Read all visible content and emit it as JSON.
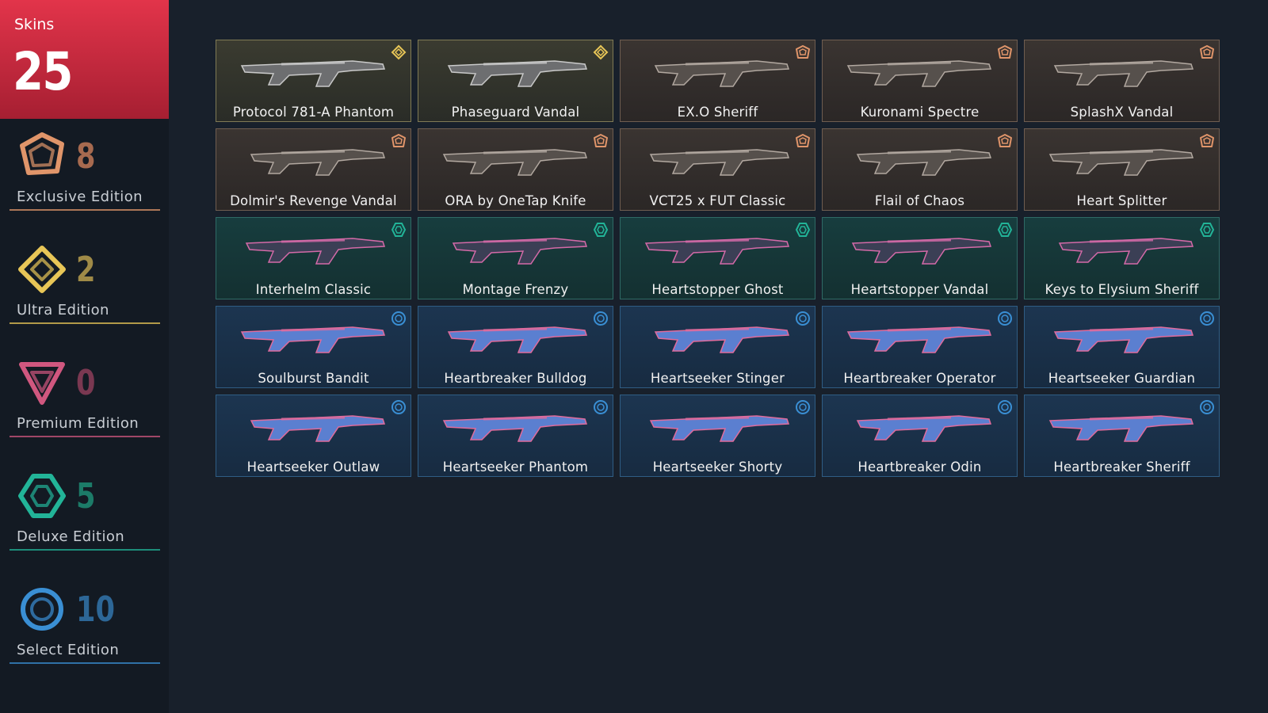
{
  "sidebar": {
    "skins_label": "Skins",
    "skins_count": "25",
    "header_color": "#e2344a",
    "editions": [
      {
        "count": "8",
        "label": "Exclusive Edition",
        "color": "#e0956a",
        "icon": "exclusive-edition-icon"
      },
      {
        "count": "2",
        "label": "Ultra Edition",
        "color": "#e8c657",
        "icon": "ultra-edition-icon"
      },
      {
        "count": "0",
        "label": "Premium Edition",
        "color": "#d0577f",
        "icon": "premium-edition-icon"
      },
      {
        "count": "5",
        "label": "Deluxe Edition",
        "color": "#22b498",
        "icon": "deluxe-edition-icon"
      },
      {
        "count": "10",
        "label": "Select Edition",
        "color": "#3a8fd4",
        "icon": "select-edition-icon"
      }
    ]
  },
  "skins": [
    {
      "name": "Protocol 781-A Phantom",
      "tier": "ultra"
    },
    {
      "name": "Phaseguard Vandal",
      "tier": "ultra"
    },
    {
      "name": "EX.O Sheriff",
      "tier": "exclusive"
    },
    {
      "name": "Kuronami Spectre",
      "tier": "exclusive"
    },
    {
      "name": "SplashX Vandal",
      "tier": "exclusive"
    },
    {
      "name": "Dolmir's Revenge Vandal",
      "tier": "exclusive"
    },
    {
      "name": "ORA by OneTap Knife",
      "tier": "exclusive"
    },
    {
      "name": "VCT25 x FUT Classic",
      "tier": "exclusive"
    },
    {
      "name": "Flail of Chaos",
      "tier": "exclusive"
    },
    {
      "name": "Heart Splitter",
      "tier": "exclusive"
    },
    {
      "name": "Interhelm Classic",
      "tier": "deluxe"
    },
    {
      "name": "Montage Frenzy",
      "tier": "deluxe"
    },
    {
      "name": "Heartstopper Ghost",
      "tier": "deluxe"
    },
    {
      "name": "Heartstopper Vandal",
      "tier": "deluxe"
    },
    {
      "name": "Keys to Elysium Sheriff",
      "tier": "deluxe"
    },
    {
      "name": "Soulburst Bandit",
      "tier": "select"
    },
    {
      "name": "Heartbreaker Bulldog",
      "tier": "select"
    },
    {
      "name": "Heartseeker Stinger",
      "tier": "select"
    },
    {
      "name": "Heartbreaker Operator",
      "tier": "select"
    },
    {
      "name": "Heartseeker Guardian",
      "tier": "select"
    },
    {
      "name": "Heartseeker Outlaw",
      "tier": "select"
    },
    {
      "name": "Heartseeker Phantom",
      "tier": "select"
    },
    {
      "name": "Heartseeker Shorty",
      "tier": "select"
    },
    {
      "name": "Heartbreaker Odin",
      "tier": "select"
    },
    {
      "name": "Heartbreaker Sheriff",
      "tier": "select"
    }
  ]
}
